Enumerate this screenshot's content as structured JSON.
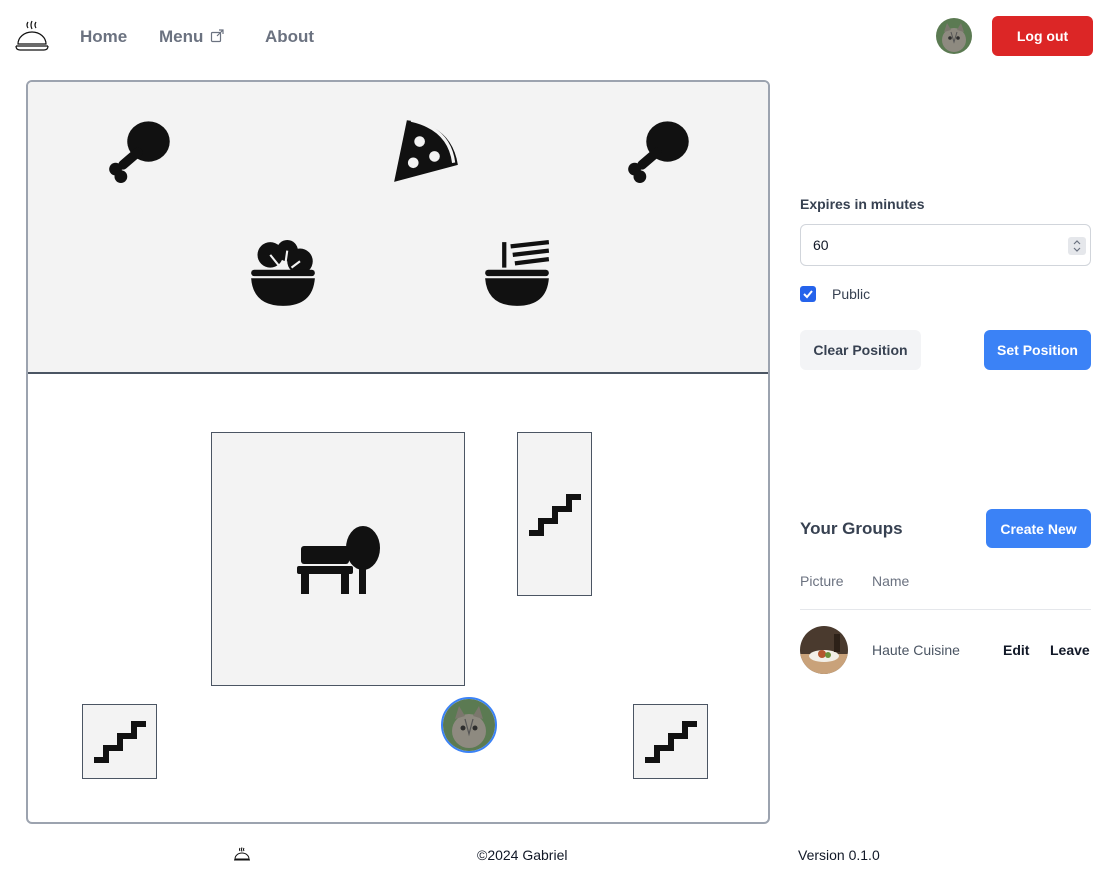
{
  "header": {
    "nav": {
      "home": "Home",
      "menu": "Menu",
      "about": "About"
    },
    "logout_label": "Log out"
  },
  "map": {
    "top_icons": [
      "drumstick-icon",
      "pizza-slice-icon",
      "drumstick-icon",
      "salad-bowl-icon",
      "rice-bowl-icon"
    ],
    "rooms": [
      "bench-tree-icon",
      "stairs-icon",
      "stairs-icon",
      "stairs-icon"
    ]
  },
  "panel": {
    "expires_label": "Expires in minutes",
    "expires_value": "60",
    "public_label": "Public",
    "public_checked": true,
    "clear_button": "Clear Position",
    "set_button": "Set Position"
  },
  "groups": {
    "title": "Your Groups",
    "create_button": "Create New",
    "columns": [
      "Picture",
      "Name"
    ],
    "rows": [
      {
        "name": "Haute Cuisine",
        "edit": "Edit",
        "leave": "Leave"
      }
    ]
  },
  "footer": {
    "copyright": "©2024 Gabriel",
    "version": "Version 0.1.0"
  },
  "colors": {
    "danger": "#dc2626",
    "primary": "#3b82f6",
    "checkbox": "#2563eb"
  }
}
